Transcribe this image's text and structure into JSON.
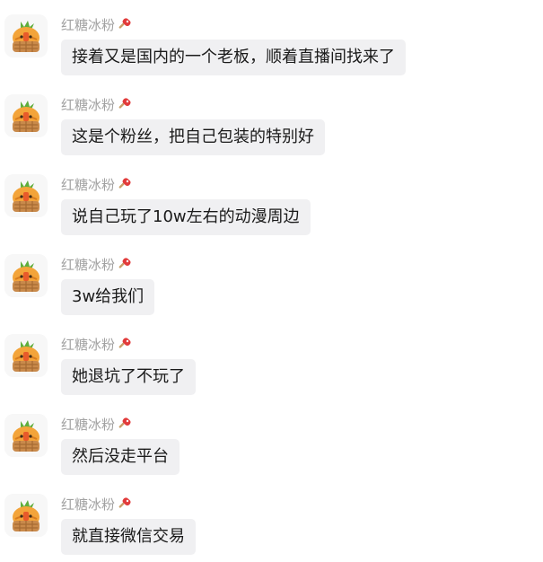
{
  "chat": {
    "messages": [
      {
        "sender": "红糖冰粉",
        "text": "接着又是国内的一个老板，顺着直播间找来了",
        "avatar_icon": "carrot-basket-avatar-icon",
        "badge_icon": "popsicle-badge-icon"
      },
      {
        "sender": "红糖冰粉",
        "text": "这是个粉丝，把自己包装的特别好",
        "avatar_icon": "carrot-basket-avatar-icon",
        "badge_icon": "popsicle-badge-icon"
      },
      {
        "sender": "红糖冰粉",
        "text": "说自己玩了10w左右的动漫周边",
        "avatar_icon": "carrot-basket-avatar-icon",
        "badge_icon": "popsicle-badge-icon"
      },
      {
        "sender": "红糖冰粉",
        "text": "3w给我们",
        "avatar_icon": "carrot-basket-avatar-icon",
        "badge_icon": "popsicle-badge-icon"
      },
      {
        "sender": "红糖冰粉",
        "text": "她退坑了不玩了",
        "avatar_icon": "carrot-basket-avatar-icon",
        "badge_icon": "popsicle-badge-icon"
      },
      {
        "sender": "红糖冰粉",
        "text": "然后没走平台",
        "avatar_icon": "carrot-basket-avatar-icon",
        "badge_icon": "popsicle-badge-icon"
      },
      {
        "sender": "红糖冰粉",
        "text": "就直接微信交易",
        "avatar_icon": "carrot-basket-avatar-icon",
        "badge_icon": "popsicle-badge-icon"
      }
    ]
  },
  "colors": {
    "bubble_bg": "#f0f0f2",
    "sender_name": "#a2a2a2",
    "message_text": "#1a1a1a",
    "avatar_orange": "#f3a43a",
    "badge_red": "#e23b3b"
  }
}
